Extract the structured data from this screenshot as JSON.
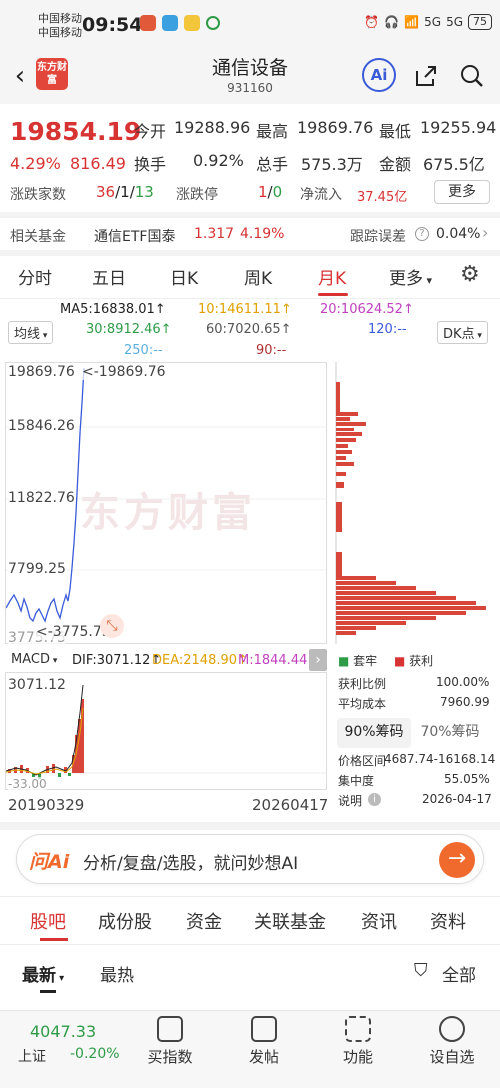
{
  "status_bar": {
    "carrier1": "中国移动",
    "carrier2": "中国移动",
    "time": "09:54",
    "network": "5G",
    "network2": "5G",
    "battery": "75"
  },
  "header": {
    "title": "通信设备",
    "code": "931160",
    "logo": "东方财富",
    "ai_label": "Ai"
  },
  "quote": {
    "price": "19854.19",
    "change_pct": "4.29%",
    "change_amt": "816.49",
    "open_label": "今开",
    "open": "19288.96",
    "high_label": "最高",
    "high": "19869.76",
    "low_label": "最低",
    "low": "19255.94",
    "turnover_label": "换手",
    "turnover": "0.92%",
    "volume_label": "总手",
    "volume": "575.3万",
    "amount_label": "金额",
    "amount": "675.5亿",
    "breadth_label": "涨跌家数",
    "breadth_up": "36",
    "breadth_flat": "1",
    "breadth_down": "13",
    "sep": "/",
    "limit_label": "涨跌停",
    "limit_up": "1",
    "limit_down": "0",
    "inflow_label": "净流入",
    "inflow": "37.45亿",
    "more": "更多"
  },
  "fund": {
    "label": "相关基金",
    "name": "通信ETF国泰",
    "price": "1.317",
    "pct": "4.19%",
    "tracking_label": "跟踪误差",
    "tracking": "0.04%"
  },
  "tabs": [
    "分时",
    "五日",
    "日K",
    "周K",
    "月K",
    "更多"
  ],
  "ma": {
    "ma5": "MA5:16838.01↑",
    "ma10": "10:14611.11↑",
    "ma20": "20:10624.52↑",
    "ma30": "30:8912.46↑",
    "ma60": "60:7020.65↑",
    "ma120": "120:--",
    "ma250": "250:--",
    "ma90": "90:--",
    "line_select": "均线",
    "dk": "DK点"
  },
  "kchart": {
    "y_labels": [
      "19869.76",
      "15846.26",
      "11822.76",
      "7799.25",
      "3775.75"
    ],
    "high_marker": "<-19869.76",
    "low_marker": "<-3775.75",
    "watermark": "东方财富"
  },
  "macd": {
    "label": "MACD",
    "dif": "DIF:3071.12↑",
    "dea": "DEA:2148.90↑",
    "m": "M:1844.44↑",
    "top": "3071.12",
    "bottom": "-33.00",
    "date_start": "20190329",
    "date_end": "20260417"
  },
  "chips": {
    "legend_loss": "套牢",
    "legend_profit": "获利",
    "profit_ratio_label": "获利比例",
    "profit_ratio": "100.00%",
    "avg_cost_label": "平均成本",
    "avg_cost": "7960.99",
    "tab90": "90%筹码",
    "tab70": "70%筹码",
    "range_label": "价格区间",
    "range": "4687.74-16168.14",
    "concentration_label": "集中度",
    "concentration": "55.05%",
    "note_label": "说明",
    "date": "2026-04-17"
  },
  "ask": {
    "brand": "问Ai",
    "placeholder": "分析/复盘/选股，就问妙想AI"
  },
  "bottom_tabs": [
    "股吧",
    "成份股",
    "资金",
    "关联基金",
    "资讯",
    "资料"
  ],
  "sort": {
    "latest": "最新",
    "hot": "最热",
    "filter": "全部"
  },
  "bottom_nav": {
    "index_price": "4047.33",
    "index_name": "上证",
    "index_pct": "-0.20%",
    "buy": "买指数",
    "post": "发帖",
    "func": "功能",
    "watch": "设自选"
  },
  "colors": {
    "up": "#d83333",
    "down": "#2e9c47",
    "accent": "#3a5bd8",
    "orange": "#f06a2d"
  }
}
